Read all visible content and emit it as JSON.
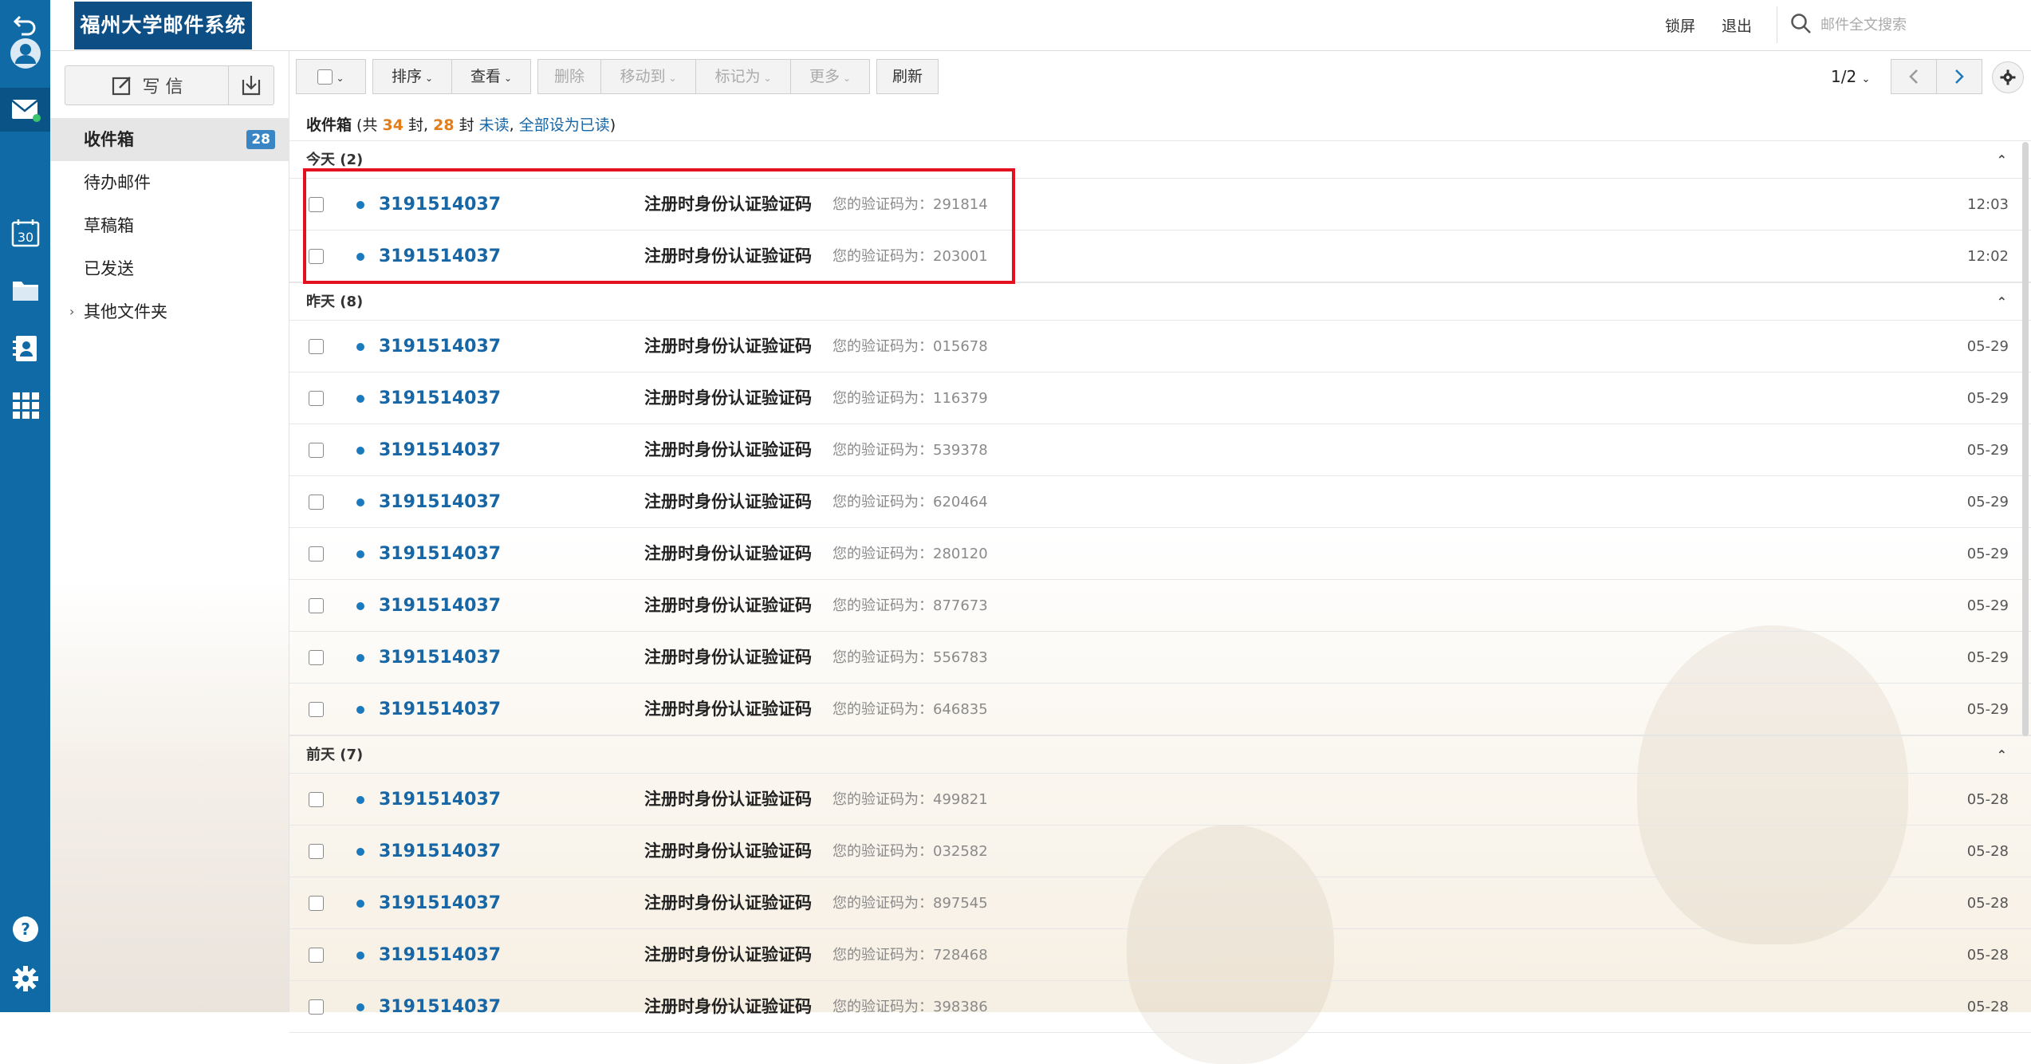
{
  "header": {
    "logo_text": "福州大学邮件系统",
    "lock_label": "锁屏",
    "logout_label": "退出",
    "search_placeholder": "邮件全文搜索"
  },
  "iconbar": {
    "items": [
      {
        "name": "back-icon"
      },
      {
        "name": "avatar"
      },
      {
        "name": "mail-icon"
      },
      {
        "name": "calendar-icon",
        "text": "30"
      },
      {
        "name": "folder-icon"
      },
      {
        "name": "contacts-icon"
      },
      {
        "name": "apps-grid-icon"
      },
      {
        "name": "help-icon"
      },
      {
        "name": "settings-icon"
      }
    ]
  },
  "sidebar": {
    "compose_label": "写 信",
    "folders": [
      {
        "label": "收件箱",
        "count": "28"
      },
      {
        "label": "待办邮件"
      },
      {
        "label": "草稿箱"
      },
      {
        "label": "已发送"
      },
      {
        "label": "其他文件夹"
      }
    ]
  },
  "toolbar": {
    "sort": "排序",
    "view": "查看",
    "delete": "删除",
    "move_to": "移动到",
    "mark_as": "标记为",
    "more": "更多",
    "refresh": "刷新",
    "page": "1/2"
  },
  "summary": {
    "folder": "收件箱",
    "prefix": " (共 ",
    "total": "34",
    "mid": " 封, ",
    "unread": "28",
    "suffix": " 封 ",
    "unread_link": "未读",
    "comma": ", ",
    "mark_all_link": "全部设为已读",
    "close": ")"
  },
  "groups": [
    {
      "title": "今天 (2)",
      "mails": [
        {
          "sender": "3191514037",
          "subject": "注册时身份认证验证码",
          "preview": "您的验证码为：291814",
          "time": "12:03"
        },
        {
          "sender": "3191514037",
          "subject": "注册时身份认证验证码",
          "preview": "您的验证码为：203001",
          "time": "12:02"
        }
      ]
    },
    {
      "title": "昨天 (8)",
      "mails": [
        {
          "sender": "3191514037",
          "subject": "注册时身份认证验证码",
          "preview": "您的验证码为：015678",
          "time": "05-29"
        },
        {
          "sender": "3191514037",
          "subject": "注册时身份认证验证码",
          "preview": "您的验证码为：116379",
          "time": "05-29"
        },
        {
          "sender": "3191514037",
          "subject": "注册时身份认证验证码",
          "preview": "您的验证码为：539378",
          "time": "05-29"
        },
        {
          "sender": "3191514037",
          "subject": "注册时身份认证验证码",
          "preview": "您的验证码为：620464",
          "time": "05-29"
        },
        {
          "sender": "3191514037",
          "subject": "注册时身份认证验证码",
          "preview": "您的验证码为：280120",
          "time": "05-29"
        },
        {
          "sender": "3191514037",
          "subject": "注册时身份认证验证码",
          "preview": "您的验证码为：877673",
          "time": "05-29"
        },
        {
          "sender": "3191514037",
          "subject": "注册时身份认证验证码",
          "preview": "您的验证码为：556783",
          "time": "05-29"
        },
        {
          "sender": "3191514037",
          "subject": "注册时身份认证验证码",
          "preview": "您的验证码为：646835",
          "time": "05-29"
        }
      ]
    },
    {
      "title": "前天 (7)",
      "mails": [
        {
          "sender": "3191514037",
          "subject": "注册时身份认证验证码",
          "preview": "您的验证码为：499821",
          "time": "05-28"
        },
        {
          "sender": "3191514037",
          "subject": "注册时身份认证验证码",
          "preview": "您的验证码为：032582",
          "time": "05-28"
        },
        {
          "sender": "3191514037",
          "subject": "注册时身份认证验证码",
          "preview": "您的验证码为：897545",
          "time": "05-28"
        },
        {
          "sender": "3191514037",
          "subject": "注册时身份认证验证码",
          "preview": "您的验证码为：728468",
          "time": "05-28"
        },
        {
          "sender": "3191514037",
          "subject": "注册时身份认证验证码",
          "preview": "您的验证码为：398386",
          "time": "05-28"
        }
      ]
    }
  ],
  "colors": {
    "iconbar_bg": "#0f6aa6",
    "logo_bg": "#0d4f85",
    "sender_blue": "#1766a6",
    "highlight_red": "#e3101f",
    "count_badge": "#3a86c4",
    "summary_orange": "#e27d1a"
  }
}
